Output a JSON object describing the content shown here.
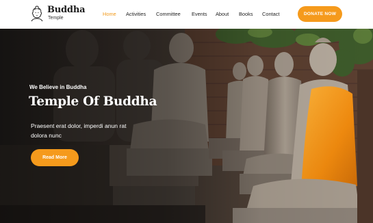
{
  "brand": {
    "title": "Buddha",
    "subtitle": "Temple",
    "logo_icon": "buddha-head-icon"
  },
  "nav": {
    "items": [
      {
        "label": "Home",
        "active": true
      },
      {
        "label": "Activities",
        "active": false
      },
      {
        "label": "Committee",
        "active": false
      },
      {
        "label": "Events",
        "active": false
      },
      {
        "label": "About",
        "active": false
      },
      {
        "label": "Books",
        "active": false
      },
      {
        "label": "Contact",
        "active": false
      }
    ]
  },
  "donate": {
    "label": "DONATE NOW"
  },
  "hero": {
    "tagline": "We Believe in Buddha",
    "title": "Temple Of Buddha",
    "text": "Praesent erat dolor, imperdi anun rat dolora nunc",
    "button_label": "Read More"
  },
  "colors": {
    "accent": "#f59a1c",
    "nav_active": "#f29a1b",
    "header_bg": "#ffffff",
    "robe": "#f08a0e"
  }
}
